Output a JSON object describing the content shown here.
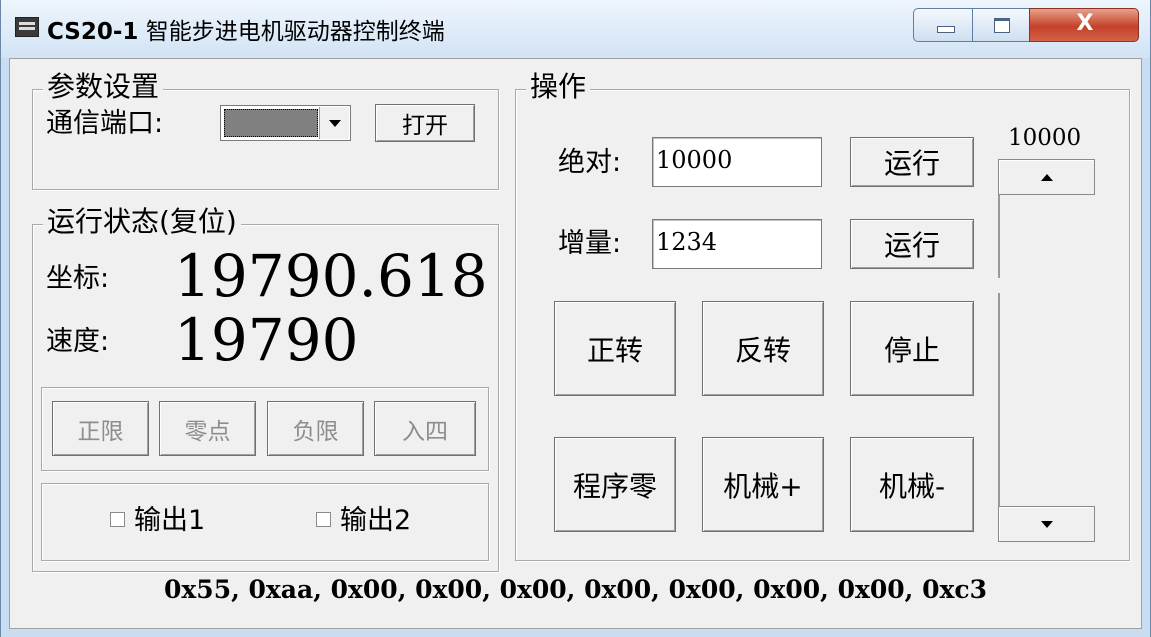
{
  "window": {
    "title_bold": "CS20-1",
    "title_rest": " 智能步进电机驱动器控制终端",
    "close_glyph": "X"
  },
  "params": {
    "title": "参数设置",
    "port_label": "通信端口:",
    "open_button": "打开"
  },
  "status_group": {
    "title": "运行状态(复位)",
    "coord_label": "坐标:",
    "coord_value": "19790.618",
    "speed_label": "速度:",
    "speed_value": "19790"
  },
  "limits": {
    "pos_limit": "正限",
    "zero": "零点",
    "neg_limit": "负限",
    "input4": "入四"
  },
  "outputs": {
    "out1": "输出1",
    "out2": "输出2"
  },
  "operation": {
    "title": "操作",
    "absolute_label": "绝对:",
    "absolute_value": "10000",
    "absolute_run": "运行",
    "increment_label": "增量:",
    "increment_value": "1234",
    "increment_run": "运行",
    "forward": "正转",
    "reverse": "反转",
    "stop": "停止",
    "program_zero": "程序零",
    "mech_plus": "机械+",
    "mech_minus": "机械-",
    "scroll_value": "10000"
  },
  "status_bar": {
    "bytes": "0x55, 0xaa, 0x00, 0x00, 0x00, 0x00, 0x00, 0x00, 0x00, 0xc3"
  },
  "icons": {
    "app": "app-icon",
    "minimize": "minimize-icon",
    "maximize": "maximize-icon",
    "close": "close-icon"
  }
}
